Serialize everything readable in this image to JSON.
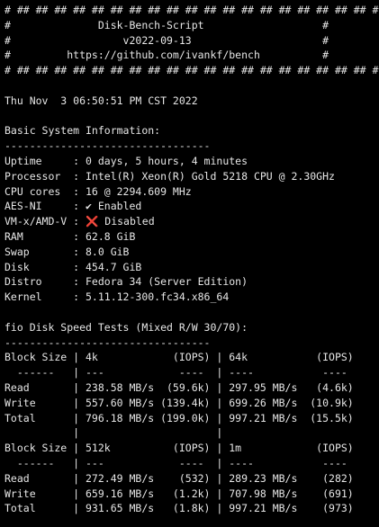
{
  "banner": {
    "border": "# ## ## ## ## ## ## ## ## ## ## ## ## ## ## ## ## ## ## ## #",
    "line1": "#              Disk-Bench-Script                   #",
    "line2": "#                  v2022-09-13                     #",
    "line3": "#         https://github.com/ivankf/bench          #"
  },
  "timestamp": "Thu Nov  3 06:50:51 PM CST 2022",
  "system": {
    "heading": "Basic System Information:",
    "rule": "---------------------------------",
    "rows": [
      {
        "line": "Uptime     : 0 days, 5 hours, 4 minutes"
      },
      {
        "line": "Processor  : Intel(R) Xeon(R) Gold 5218 CPU @ 2.30GHz"
      },
      {
        "line": "CPU cores  : 16 @ 2294.609 MHz"
      }
    ],
    "aes": {
      "label": "AES-NI     : ",
      "icon": "✔",
      "value": " Enabled",
      "icon_name": "check-icon"
    },
    "vmx": {
      "label": "VM-x/AMD-V : ",
      "icon": "❌",
      "value": " Disabled",
      "icon_name": "cross-icon",
      "icon_color": "#e0443e"
    },
    "rows2": [
      {
        "line": "RAM        : 62.8 GiB"
      },
      {
        "line": "Swap       : 8.0 GiB"
      },
      {
        "line": "Disk       : 454.7 GiB"
      },
      {
        "line": "Distro     : Fedora 34 (Server Edition)"
      },
      {
        "line": "Kernel     : 5.11.12-300.fc34.x86_64"
      }
    ]
  },
  "fio": {
    "heading": "fio Disk Speed Tests (Mixed R/W 30/70):",
    "rule": "---------------------------------",
    "table1": [
      "Block Size | 4k            (IOPS) | 64k           (IOPS)",
      "  ------   | ---            ----  | ----           ---- ",
      "Read       | 238.58 MB/s  (59.6k) | 297.95 MB/s   (4.6k)",
      "Write      | 557.60 MB/s (139.4k) | 699.26 MB/s  (10.9k)",
      "Total      | 796.18 MB/s (199.0k) | 997.21 MB/s  (15.5k)",
      "           |                      |                     "
    ],
    "table2": [
      "Block Size | 512k          (IOPS) | 1m            (IOPS)",
      "  ------   | ---            ----  | ----           ---- ",
      "Read       | 272.49 MB/s    (532) | 289.23 MB/s    (282)",
      "Write      | 659.16 MB/s   (1.2k) | 707.98 MB/s    (691)",
      "Total      | 931.65 MB/s   (1.8k) | 997.21 MB/s    (973)"
    ]
  }
}
